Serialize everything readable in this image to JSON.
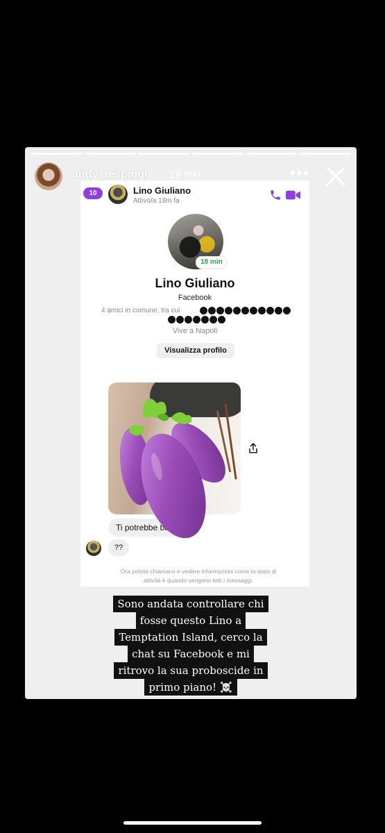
{
  "story": {
    "username": "andy_respiggi",
    "time_ago": "19 min",
    "more_label": "•••",
    "progress_segments": 6
  },
  "chat": {
    "back_count": "10",
    "contact_name": "Lino Giuliano",
    "contact_status": "Attivo/a 18m fa",
    "profile": {
      "active_badge": "18 min",
      "name": "Lino Giuliano",
      "platform": "Facebook",
      "mutual_friends": "4 amici in comune, tra cui",
      "location": "Vive a Napoli",
      "view_profile_button": "Visualizza profilo"
    },
    "messages": [
      {
        "text": "Ti potrebbe bas"
      },
      {
        "text": "??"
      }
    ],
    "info_note_line1": "Ora potete chiamarvi e vedere informazioni come lo stato di",
    "info_note_line2": "attività e quando vengono letti i messaggi."
  },
  "caption": {
    "lines": [
      "Sono andata controllare chi",
      "fosse questo Lino a",
      "Temptation Island, cerco la",
      "chat su Facebook e mi",
      "ritrovo la sua proboscide in",
      "primo piano! ☠️"
    ]
  },
  "colors": {
    "messenger_accent": "#8f3fe0",
    "online_green": "#31a24c",
    "eggplant": "#9b4db8",
    "caption_bg": "#111111"
  },
  "icons": [
    "close-icon",
    "more-icon",
    "back-arrow-icon",
    "phone-icon",
    "video-camera-icon",
    "share-icon",
    "eggplant-emoji"
  ]
}
